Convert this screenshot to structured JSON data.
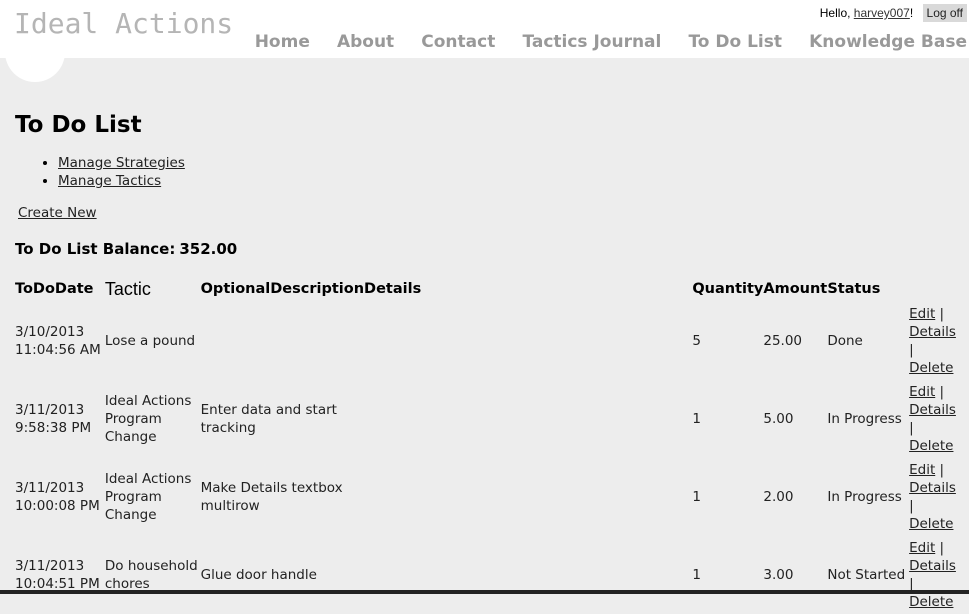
{
  "site": {
    "title": "Ideal Actions",
    "greeting_prefix": "Hello, ",
    "username": "harvey007",
    "greeting_suffix": "!",
    "logoff": "Log off"
  },
  "nav": [
    "Home",
    "About",
    "Contact",
    "Tactics Journal",
    "To Do List",
    "Knowledge Base"
  ],
  "page": {
    "title": "To Do List",
    "links": [
      "Manage Strategies",
      "Manage Tactics"
    ],
    "create_new": "Create New",
    "balance_label": "To Do List Balance:",
    "balance_value": "352.00"
  },
  "table": {
    "headers": {
      "date": "ToDoDate",
      "tactic": "Tactic",
      "desc": "OptionalDescription",
      "details": "Details",
      "qty": "Quantity",
      "amount": "Amount",
      "status": "Status"
    },
    "action_labels": {
      "edit": "Edit",
      "details": "Details",
      "delete": "Delete",
      "sep": "|"
    },
    "rows": [
      {
        "date": "3/10/2013 11:04:56 AM",
        "tactic": "Lose a pound",
        "desc": "",
        "details": "",
        "qty": "5",
        "amount": "25.00",
        "status": "Done"
      },
      {
        "date": "3/11/2013 9:58:38 PM",
        "tactic": "Ideal Actions Program Change",
        "desc": "Enter data and start tracking",
        "details": "",
        "qty": "1",
        "amount": "5.00",
        "status": "In Progress"
      },
      {
        "date": "3/11/2013 10:00:08 PM",
        "tactic": "Ideal Actions Program Change",
        "desc": "Make Details textbox multirow",
        "details": "",
        "qty": "1",
        "amount": "2.00",
        "status": "In Progress"
      },
      {
        "date": "3/11/2013 10:04:51 PM",
        "tactic": "Do household chores",
        "desc": "Glue door handle",
        "details": "",
        "qty": "1",
        "amount": "3.00",
        "status": "Not Started"
      }
    ]
  }
}
